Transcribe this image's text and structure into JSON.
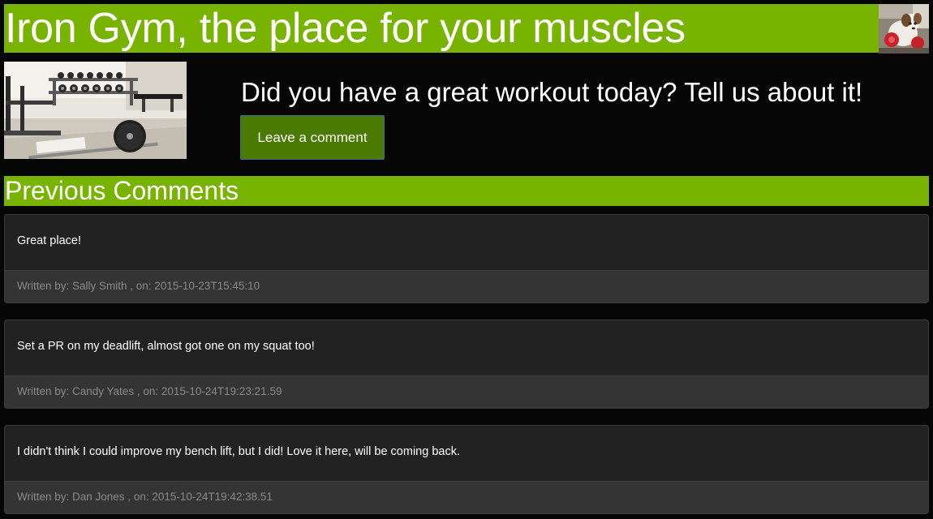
{
  "header": {
    "title": "Iron Gym, the place for your muscles",
    "avatar_icon": "dog-photo",
    "accent_color": "#78b300"
  },
  "hero": {
    "photo_icon": "gym-equipment-photo",
    "heading": "Did you have a great workout today? Tell us about it!",
    "button_label": "Leave a comment",
    "button_color": "#4a7a00"
  },
  "comments_section": {
    "title": "Previous Comments",
    "comments": [
      {
        "text": "Great place!",
        "meta": "Written by: Sally Smith , on: 2015-10-23T15:45:10"
      },
      {
        "text": "Set a PR on my deadlift, almost got one on my squat too!",
        "meta": "Written by: Candy Yates , on: 2015-10-24T19:23:21.59"
      },
      {
        "text": "I didn't think I could improve my bench lift, but I did! Love it here, will be coming back.",
        "meta": "Written by: Dan Jones , on: 2015-10-24T19:42:38.51"
      }
    ]
  }
}
